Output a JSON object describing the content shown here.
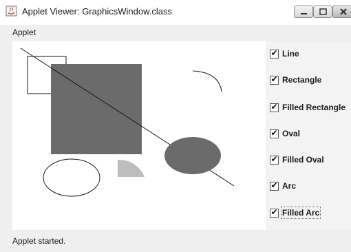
{
  "window": {
    "title": "Applet Viewer: GraphicsWindow.class"
  },
  "menu": {
    "items": [
      "Applet"
    ]
  },
  "canvas": {
    "shapes": [
      "line",
      "rectangle",
      "filled-rectangle",
      "oval",
      "filled-oval",
      "arc",
      "filled-arc"
    ],
    "fill_color": "#6b6b6b",
    "arc_fill_color": "#bdbdbd",
    "stroke_color": "#111111",
    "background": "#ffffff"
  },
  "checkboxes": [
    {
      "label": "Line",
      "checked": true
    },
    {
      "label": "Rectangle",
      "checked": true
    },
    {
      "label": "Filled Rectangle",
      "checked": true
    },
    {
      "label": "Oval",
      "checked": true
    },
    {
      "label": "Filled Oval",
      "checked": true
    },
    {
      "label": "Arc",
      "checked": true
    },
    {
      "label": "Filled Arc",
      "checked": true
    }
  ],
  "status": {
    "text": "Applet started."
  },
  "icons": {
    "app": "java-applet-icon",
    "minimize": "minimize-icon",
    "maximize": "maximize-icon",
    "close": "close-icon",
    "check": "checkmark-icon"
  }
}
